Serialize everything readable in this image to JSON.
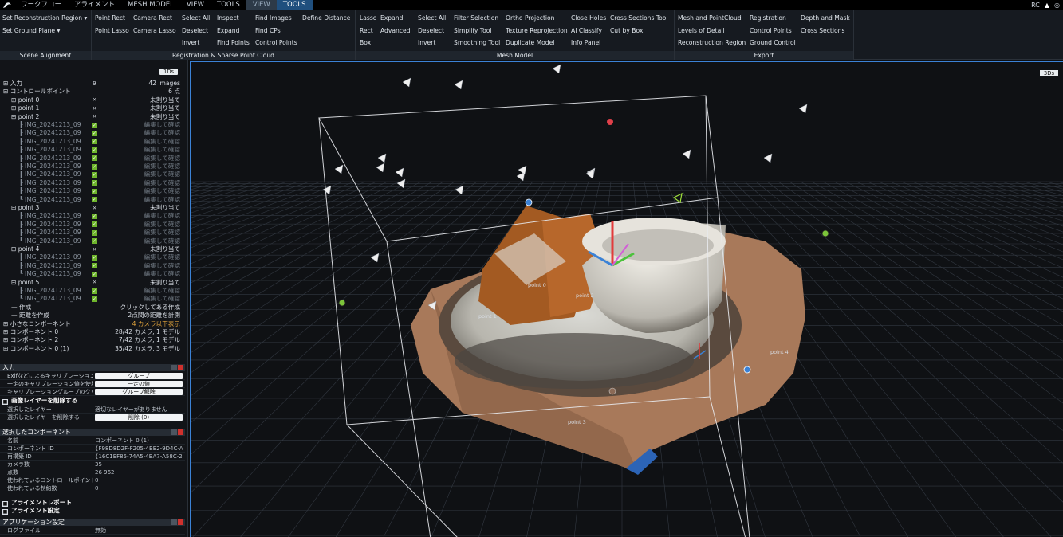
{
  "topbar": {
    "tabs": [
      {
        "label": "ワークフロー",
        "state": "normal"
      },
      {
        "label": "アライメント",
        "state": "normal"
      },
      {
        "label": "MESH MODEL",
        "state": "normal"
      },
      {
        "label": "VIEW",
        "state": "normal"
      },
      {
        "label": "TOOLS",
        "state": "normal"
      },
      {
        "label": "VIEW",
        "state": "pale"
      },
      {
        "label": "TOOLS",
        "state": "selected"
      }
    ],
    "user": "RC"
  },
  "ribbon": {
    "scene_alignment": {
      "title": "Scene Alignment",
      "items": [
        "Set Reconstruction Region ▾",
        "Set Ground Plane ▾"
      ]
    },
    "registration": {
      "title": "Registration & Sparse Point Cloud",
      "items": [
        [
          "Point Rect",
          "Camera Rect",
          "Select All",
          "Inspect",
          "Find Images",
          "Define Distance"
        ],
        [
          "Point Lasso",
          "Camera Lasso",
          "Deselect",
          "Expand",
          "Find CPs",
          ""
        ],
        [
          "",
          "",
          "Invert",
          "Find Points",
          "Control Points",
          ""
        ]
      ]
    },
    "mesh_model": {
      "title": "Mesh Model",
      "items": [
        [
          "Lasso",
          "Expand",
          "Select All",
          "Filter Selection",
          "Ortho Projection",
          "Close Holes",
          "Cross Sections Tool"
        ],
        [
          "Rect",
          "Advanced",
          "Deselect",
          "Simplify Tool",
          "Texture Reprojection",
          "AI Classify",
          "Cut by Box"
        ],
        [
          "Box",
          "",
          "Invert",
          "Smoothing Tool",
          "Duplicate Model",
          "Info Panel",
          ""
        ]
      ]
    },
    "export": {
      "title": "Export",
      "items": [
        [
          "Mesh and PointCloud",
          "Registration",
          "Depth and Mask"
        ],
        [
          "Levels of Detail",
          "Control Points",
          "Cross Sections"
        ],
        [
          "Reconstruction Region",
          "Ground Control",
          ""
        ]
      ]
    }
  },
  "tree": {
    "badge": "1Ds",
    "rows": [
      {
        "label": "⊞ 入力",
        "icon": "9",
        "status": "42 images",
        "indent": 0
      },
      {
        "label": "⊟ コントロールポイント",
        "icon": "",
        "status": "6 点",
        "indent": 0
      },
      {
        "label": "⊞ point 0",
        "icon": "×",
        "status": "未割り当て",
        "indent": 1
      },
      {
        "label": "⊞ point 1",
        "icon": "×",
        "status": "未割り当て",
        "indent": 1
      },
      {
        "label": "⊟ point 2",
        "icon": "×",
        "status": "未割り当て",
        "indent": 1
      },
      {
        "label": "┠ IMG_20241213_09",
        "icon": "✓",
        "status": "編集して確認",
        "indent": 2
      },
      {
        "label": "┠ IMG_20241213_09",
        "icon": "✓",
        "status": "編集して確認",
        "indent": 2
      },
      {
        "label": "┠ IMG_20241213_09",
        "icon": "✓",
        "status": "編集して確認",
        "indent": 2
      },
      {
        "label": "┠ IMG_20241213_09",
        "icon": "✓",
        "status": "編集して確認",
        "indent": 2
      },
      {
        "label": "┠ IMG_20241213_09",
        "icon": "✓",
        "status": "編集して確認",
        "indent": 2
      },
      {
        "label": "┠ IMG_20241213_09",
        "icon": "✓",
        "status": "編集して確認",
        "indent": 2
      },
      {
        "label": "┠ IMG_20241213_09",
        "icon": "✓",
        "status": "編集して確認",
        "indent": 2
      },
      {
        "label": "┠ IMG_20241213_09",
        "icon": "✓",
        "status": "編集して確認",
        "indent": 2
      },
      {
        "label": "┠ IMG_20241213_09",
        "icon": "✓",
        "status": "編集して確認",
        "indent": 2
      },
      {
        "label": "┖ IMG_20241213_09",
        "icon": "✓",
        "status": "編集して確認",
        "indent": 2
      },
      {
        "label": "⊟ point 3",
        "icon": "×",
        "status": "未割り当て",
        "indent": 1
      },
      {
        "label": "┠ IMG_20241213_09",
        "icon": "✓",
        "status": "編集して確認",
        "indent": 2
      },
      {
        "label": "┠ IMG_20241213_09",
        "icon": "✓",
        "status": "編集して確認",
        "indent": 2
      },
      {
        "label": "┠ IMG_20241213_09",
        "icon": "✓",
        "status": "編集して確認",
        "indent": 2
      },
      {
        "label": "┖ IMG_20241213_09",
        "icon": "✓",
        "status": "編集して確認",
        "indent": 2
      },
      {
        "label": "⊟ point 4",
        "icon": "×",
        "status": "未割り当て",
        "indent": 1
      },
      {
        "label": "┠ IMG_20241213_09",
        "icon": "✓",
        "status": "編集して確認",
        "indent": 2
      },
      {
        "label": "┠ IMG_20241213_09",
        "icon": "✓",
        "status": "編集して確認",
        "indent": 2
      },
      {
        "label": "┖ IMG_20241213_09",
        "icon": "✓",
        "status": "編集して確認",
        "indent": 2
      },
      {
        "label": "⊟ point 5",
        "icon": "×",
        "status": "未割り当て",
        "indent": 1
      },
      {
        "label": "┠ IMG_20241213_09",
        "icon": "✓",
        "status": "編集して確認",
        "indent": 2
      },
      {
        "label": "┖ IMG_20241213_09",
        "icon": "✓",
        "status": "編集して確認",
        "indent": 2
      },
      {
        "label": "— 作成",
        "icon": "",
        "status": "クリックしてある作成",
        "indent": 1
      },
      {
        "label": "— 距離を作成",
        "icon": "",
        "status": "2点間の距離を計測",
        "indent": 1
      },
      {
        "label": "⊞ 小さなコンポーネント",
        "icon": "",
        "status": "4 カメラ以下表示",
        "indent": 0
      },
      {
        "label": "⊞ コンポーネント 0",
        "icon": "",
        "status": "28/42 カメラ, 1 モデル",
        "indent": 0
      },
      {
        "label": "⊞ コンポーネント 2",
        "icon": "",
        "status": "7/42 カメラ, 1 モデル",
        "indent": 0
      },
      {
        "label": "⊞ コンポーネント 0 (1)",
        "icon": "",
        "status": "35/42 カメラ, 3 モデル",
        "indent": 0
      }
    ]
  },
  "input_panel": {
    "title": "入力",
    "rows": [
      {
        "key": "Exifなどによるキャリブレーショングルー...",
        "value": "グループ"
      },
      {
        "key": "一定のキャリブレーション値を使用",
        "value": "一定の値"
      },
      {
        "key": "キャリブレーショングループのクリア",
        "value": "グループ解除"
      }
    ],
    "sub": "画像レイヤーを削除する",
    "sub_rows": [
      {
        "key": "選択したレイヤー",
        "value": "適切なレイヤーがありません"
      },
      {
        "key": "選択したレイヤーを削除する",
        "value": "削除 (0)"
      }
    ]
  },
  "component_panel": {
    "title": "選択したコンポーネント",
    "rows": [
      {
        "key": "名前",
        "value": "コンポーネント 0 (1)"
      },
      {
        "key": "コンポーネント ID",
        "value": "{F98D8D2F-F205-4BE2-9D4C-A..."
      },
      {
        "key": "再構築 ID",
        "value": "{16C1EF85-74A5-4BA7-A58C-2..."
      },
      {
        "key": "カメラ数",
        "value": "35"
      },
      {
        "key": "点数",
        "value": "26 962"
      },
      {
        "key": "使われているコントロールポイント数",
        "value": "0"
      },
      {
        "key": "使われている制約数",
        "value": "0"
      }
    ],
    "subs": [
      "アライメントレポート",
      "アライメント設定"
    ]
  },
  "app_panel": {
    "title": "アプリケーション設定",
    "rows": [
      {
        "key": "ログファイル",
        "value": "無効"
      }
    ]
  },
  "viewport": {
    "badge": "3Ds",
    "point_labels": [
      "point 0",
      "point 2",
      "point 1",
      "point 4",
      "point 3"
    ]
  },
  "colors": {
    "accent": "#3b82d6",
    "check": "#6eb52c",
    "close": "#d0312d",
    "warn": "#e0a33c"
  }
}
